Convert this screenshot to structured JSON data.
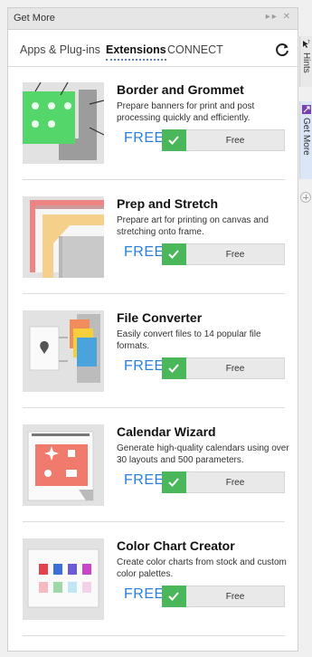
{
  "panel": {
    "title": "Get More"
  },
  "tabs": [
    {
      "label": "Apps & Plug-ins",
      "active": false
    },
    {
      "label": "Extensions",
      "active": true
    },
    {
      "label": "CONNECT",
      "active": false
    }
  ],
  "side_tabs": [
    {
      "label": "Hints",
      "icon": "pointer-help-icon"
    },
    {
      "label": "Get More",
      "icon": "get-more-icon"
    }
  ],
  "items": [
    {
      "name": "Border and Grommet",
      "description": "Prepare banners for print and post processing quickly and efficiently.",
      "price": "FREE",
      "button": "Free"
    },
    {
      "name": "Prep and Stretch",
      "description": "Prepare art for printing on canvas and stretching onto frame.",
      "price": "FREE",
      "button": "Free"
    },
    {
      "name": "File Converter",
      "description": "Easily convert files to 14 popular file formats.",
      "price": "FREE",
      "button": "Free"
    },
    {
      "name": "Calendar Wizard",
      "description": "Generate high-quality calendars using over 30 layouts and 500 parameters.",
      "price": "FREE",
      "button": "Free"
    },
    {
      "name": "Color Chart Creator",
      "description": "Create color charts from stock and custom color palettes.",
      "price": "FREE",
      "button": "Free"
    }
  ],
  "colors": {
    "accent_free": "#2b7fd8",
    "check_green": "#49b75a",
    "get_more_purple": "#7a3fb0"
  }
}
